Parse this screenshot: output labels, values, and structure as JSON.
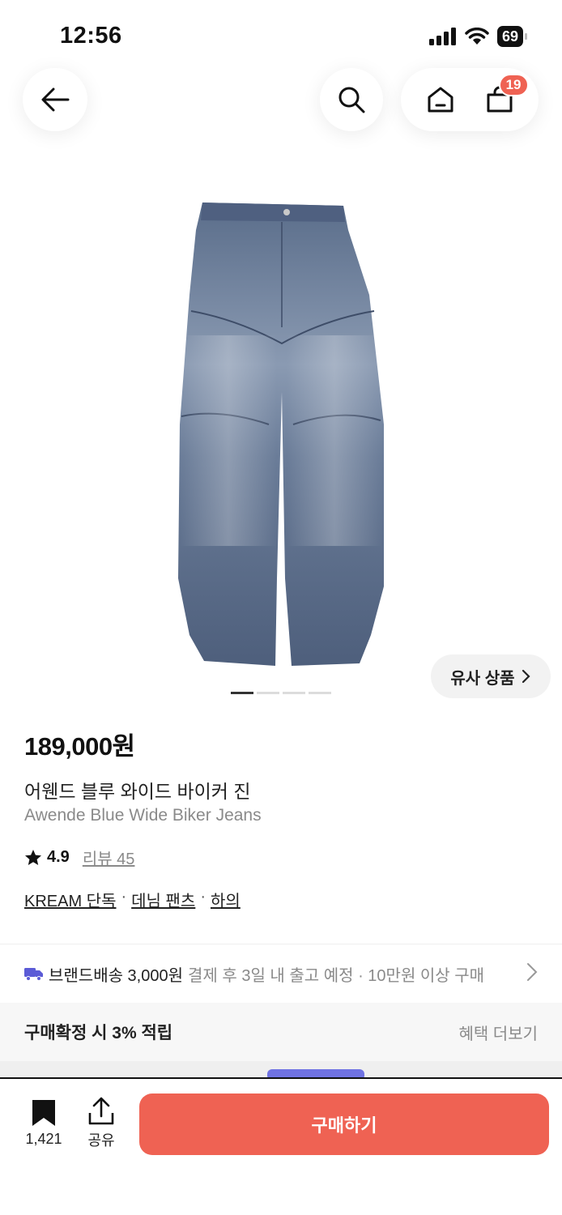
{
  "status_bar": {
    "time": "12:56",
    "battery": "69"
  },
  "header": {
    "cart_count": "19"
  },
  "product": {
    "price": "189,000원",
    "name_ko": "어웬드 블루 와이드 바이커 진",
    "name_en": "Awende Blue Wide Biker Jeans",
    "rating": "4.9",
    "review_label": "리뷰 45",
    "tags": [
      "KREAM 단독",
      "데님 팬츠",
      "하의"
    ],
    "image_count": 4,
    "image_index": 1
  },
  "similar_button": {
    "label": "유사 상품"
  },
  "shipping": {
    "label": "브랜드배송 3,000원",
    "detail": "결제 후 3일 내 출고 예정 · 10만원 이상 구매"
  },
  "benefit": {
    "label": "구매확정 시 3% 적립",
    "link": "혜택 더보기"
  },
  "bottom_bar": {
    "bookmark_count": "1,421",
    "share_label": "공유",
    "buy_label": "구매하기"
  },
  "colors": {
    "accent": "#ef6253",
    "truck": "#5b5bd6"
  },
  "icons": [
    "back-arrow-icon",
    "search-icon",
    "home-icon",
    "shopping-bag-icon",
    "star-icon",
    "truck-icon",
    "chevron-right-icon",
    "bookmark-icon",
    "share-icon"
  ]
}
